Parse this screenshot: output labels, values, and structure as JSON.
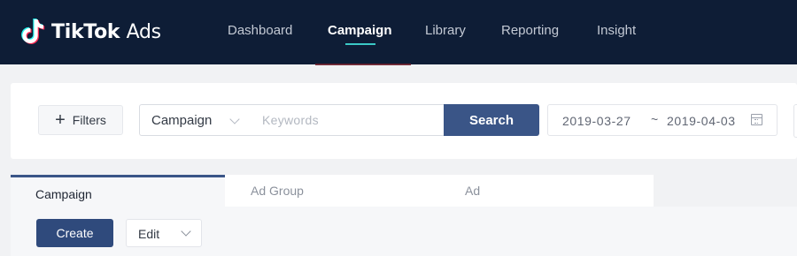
{
  "app": {
    "logo_text_bold": "TikTok",
    "logo_text_light": "Ads",
    "logo_icon": "tiktok-note-icon"
  },
  "nav": {
    "items": [
      {
        "label": "Dashboard",
        "active": false
      },
      {
        "label": "Campaign",
        "active": true
      },
      {
        "label": "Library",
        "active": false
      },
      {
        "label": "Reporting",
        "active": false
      },
      {
        "label": "Insight",
        "active": false
      }
    ]
  },
  "filters": {
    "filters_button_label": "Filters",
    "filters_icon": "plus-icon",
    "scope_select_value": "Campaign",
    "keyword_placeholder": "Keywords",
    "keyword_value": "",
    "search_button_label": "Search",
    "date_range": {
      "start": "2019-03-27",
      "separator": "~",
      "end": "2019-04-03",
      "icon": "calendar-icon"
    }
  },
  "tabs": [
    {
      "label": "Campaign",
      "active": true
    },
    {
      "label": "Ad Group",
      "active": false
    },
    {
      "label": "Ad",
      "active": false
    }
  ],
  "toolbar": {
    "create_label": "Create",
    "edit_label": "Edit"
  },
  "colors": {
    "nav_background": "#0e1d36",
    "nav_active_underline": "#3bc9c6",
    "primary_button": "#3a5587",
    "create_button": "#2f4a7c",
    "page_background": "#f1f2f4"
  }
}
